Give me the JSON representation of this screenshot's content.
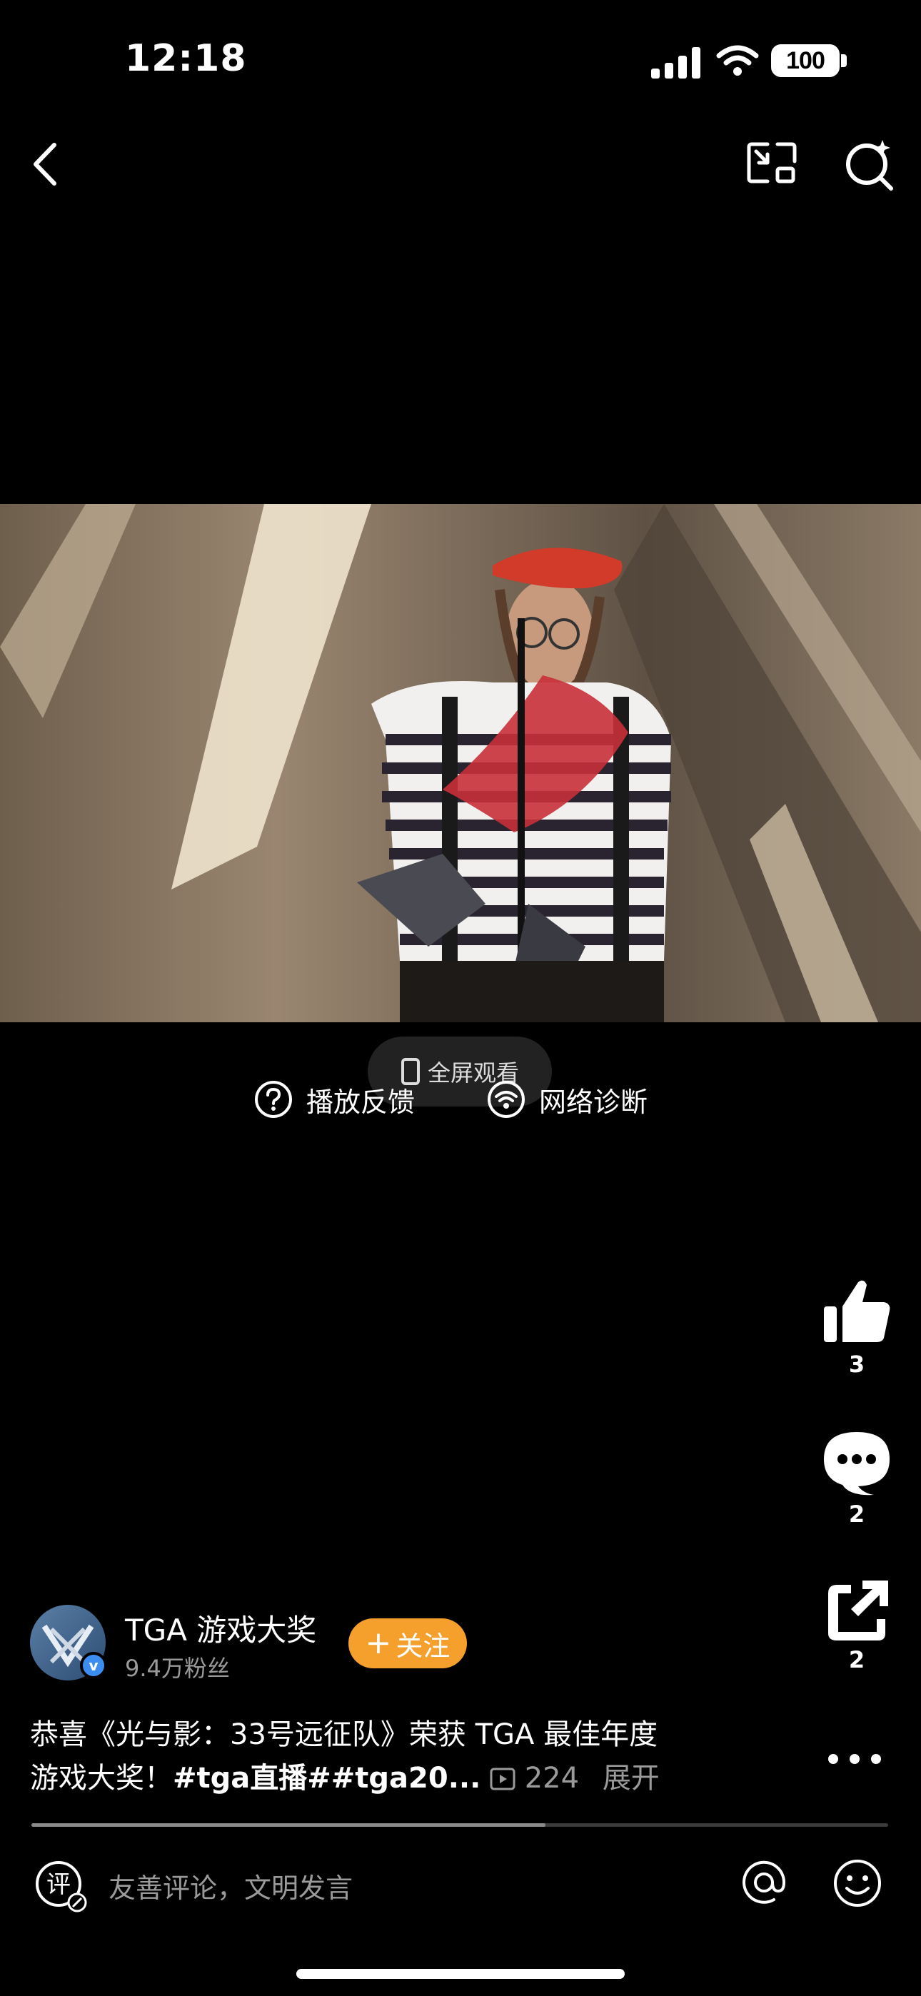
{
  "status_bar": {
    "time": "12:18",
    "battery": "100"
  },
  "nav": {
    "back_icon": "chevron-left-icon",
    "pip_icon": "picture-in-picture-icon",
    "search_icon": "search-spark-icon"
  },
  "video": {
    "fullscreen_label": "全屏观看",
    "feedback_label": "播放反馈",
    "network_label": "网络诊断"
  },
  "actions": {
    "like_count": "3",
    "comment_count": "2",
    "share_count": "2"
  },
  "author": {
    "name": "TGA 游戏大奖",
    "fans": "9.4万粉丝",
    "follow_label": "关注"
  },
  "caption": {
    "text_line1": "恭喜《光与影：33号远征队》荣获 TGA 最佳年度",
    "text_line2_prefix": "游戏大奖！",
    "tags": "#tga直播##tga20...",
    "views": "224",
    "expand_label": "展开"
  },
  "progress": {
    "fraction": 0.6
  },
  "comment_bar": {
    "placeholder": "友善评论，文明发言"
  },
  "colors": {
    "background": "#000000",
    "follow_button": "#f5a02c",
    "muted_text": "#9a9a9a"
  }
}
